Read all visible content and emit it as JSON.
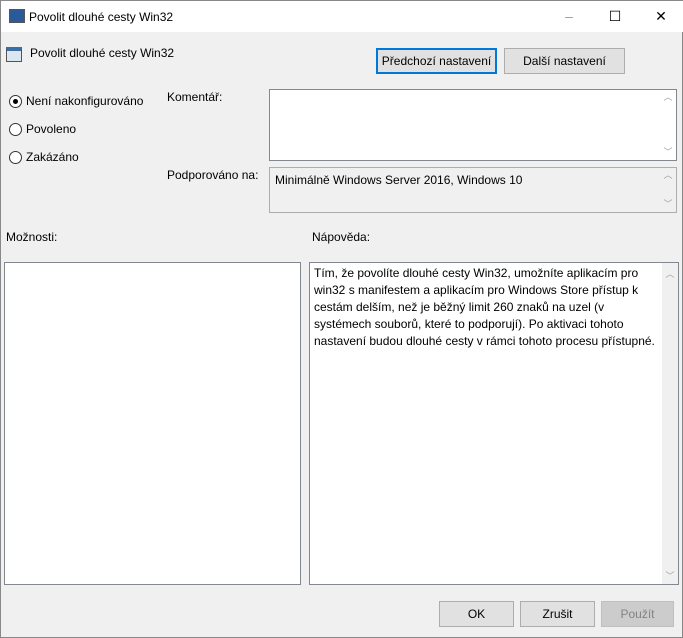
{
  "window": {
    "title": "Povolit dlouhé cesty Win32",
    "min": "–",
    "max": "☐",
    "close": "✕"
  },
  "header": {
    "policy_title": "Povolit dlouhé cesty Win32",
    "prev_button": "Předchozí nastavení",
    "next_button": "Další nastavení"
  },
  "state": {
    "options": [
      {
        "label": "Není nakonfigurováno",
        "selected": true
      },
      {
        "label": "Povoleno",
        "selected": false
      },
      {
        "label": "Zakázáno",
        "selected": false
      }
    ]
  },
  "comment": {
    "label": "Komentář:",
    "value": ""
  },
  "supported": {
    "label": "Podporováno na:",
    "value": "Minimálně Windows Server 2016, Windows 10"
  },
  "options_label": "Možnosti:",
  "help": {
    "label": "Nápověda:",
    "text": "Tím, že povolíte dlouhé cesty Win32, umožníte aplikacím pro win32 s manifestem a aplikacím pro Windows Store přístup k cestám delším, než je běžný limit 260 znaků na uzel (v systémech souborů, které to podporují). Po aktivaci tohoto nastavení budou dlouhé cesty v rámci tohoto procesu přístupné."
  },
  "footer": {
    "ok": "OK",
    "cancel": "Zrušit",
    "apply": "Použít"
  }
}
